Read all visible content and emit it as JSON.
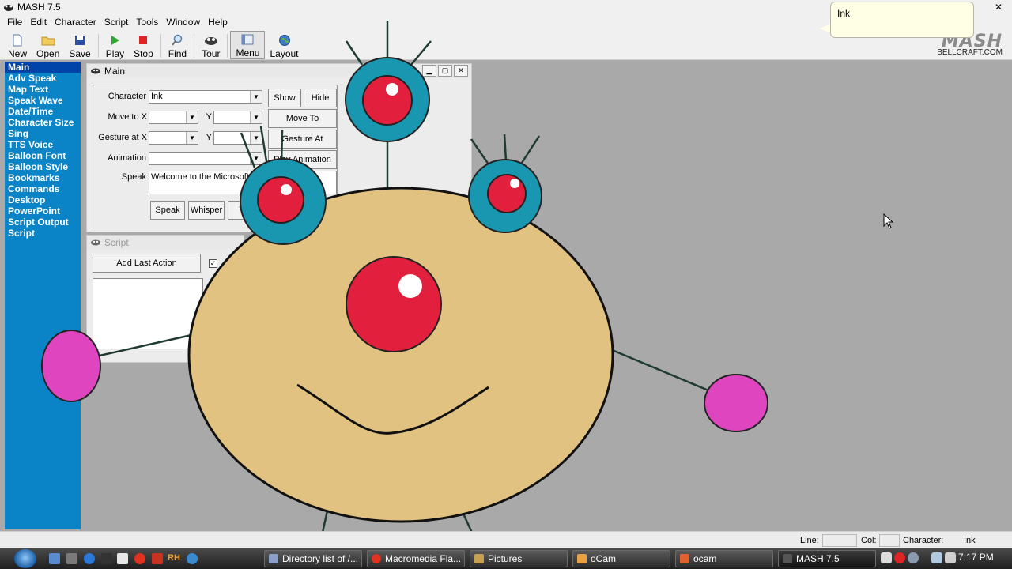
{
  "window": {
    "title": "MASH 7.5",
    "close_glyph": "✕"
  },
  "menubar": [
    "File",
    "Edit",
    "Character",
    "Script",
    "Tools",
    "Window",
    "Help"
  ],
  "toolbar": {
    "new": "New",
    "open": "Open",
    "save": "Save",
    "play": "Play",
    "stop": "Stop",
    "find": "Find",
    "tour": "Tour",
    "menu": "Menu",
    "layout": "Layout"
  },
  "logo": {
    "brand": "MASH",
    "site": "BELLCRAFT.COM"
  },
  "balloon": {
    "text": "Ink"
  },
  "sidebar": [
    "Main",
    "Adv Speak",
    "Map Text",
    "Speak Wave",
    "Date/Time",
    "Character Size",
    "Sing",
    "TTS Voice",
    "Balloon Font",
    "Balloon Style",
    "Bookmarks",
    "Commands",
    "Desktop",
    "PowerPoint",
    "Script Output",
    "Script"
  ],
  "main_window": {
    "title": "Main",
    "character_label": "Character",
    "character_value": "Ink",
    "show": "Show",
    "hide": "Hide",
    "move_to_x_label": "Move to X",
    "y_label": "Y",
    "move_to": "Move To",
    "gesture_at_x_label": "Gesture at X",
    "gesture_at": "Gesture At",
    "animation_label": "Animation",
    "play_animation": "Play Animation",
    "speak_label": "Speak",
    "speak_value": "Welcome to the Microsoft Age",
    "speak_btn": "Speak",
    "whisper_btn": "Whisper",
    "think_btn": "Thi"
  },
  "script_window": {
    "title": "Script",
    "add_last_action": "Add Last Action",
    "checkbox_mark": "✓"
  },
  "statusbar": {
    "line_label": "Line:",
    "col_label": "Col:",
    "character_label": "Character:",
    "character_value": "Ink"
  },
  "taskbar": {
    "tasks": [
      "Directory list of /...",
      "Macromedia Fla...",
      "Pictures",
      "oCam",
      "ocam",
      "MASH 7.5"
    ],
    "quicklaunch_text": "RH",
    "clock": "7:17 PM"
  },
  "colors": {
    "sidebar_bg": "#0a84c6",
    "sidebar_selected": "#0044aa",
    "desktop_bg": "#a9a9a9",
    "char_body": "#e2c281",
    "char_eye_ring": "#1996b0",
    "char_eye": "#e21f3d",
    "char_hand": "#de45be"
  }
}
